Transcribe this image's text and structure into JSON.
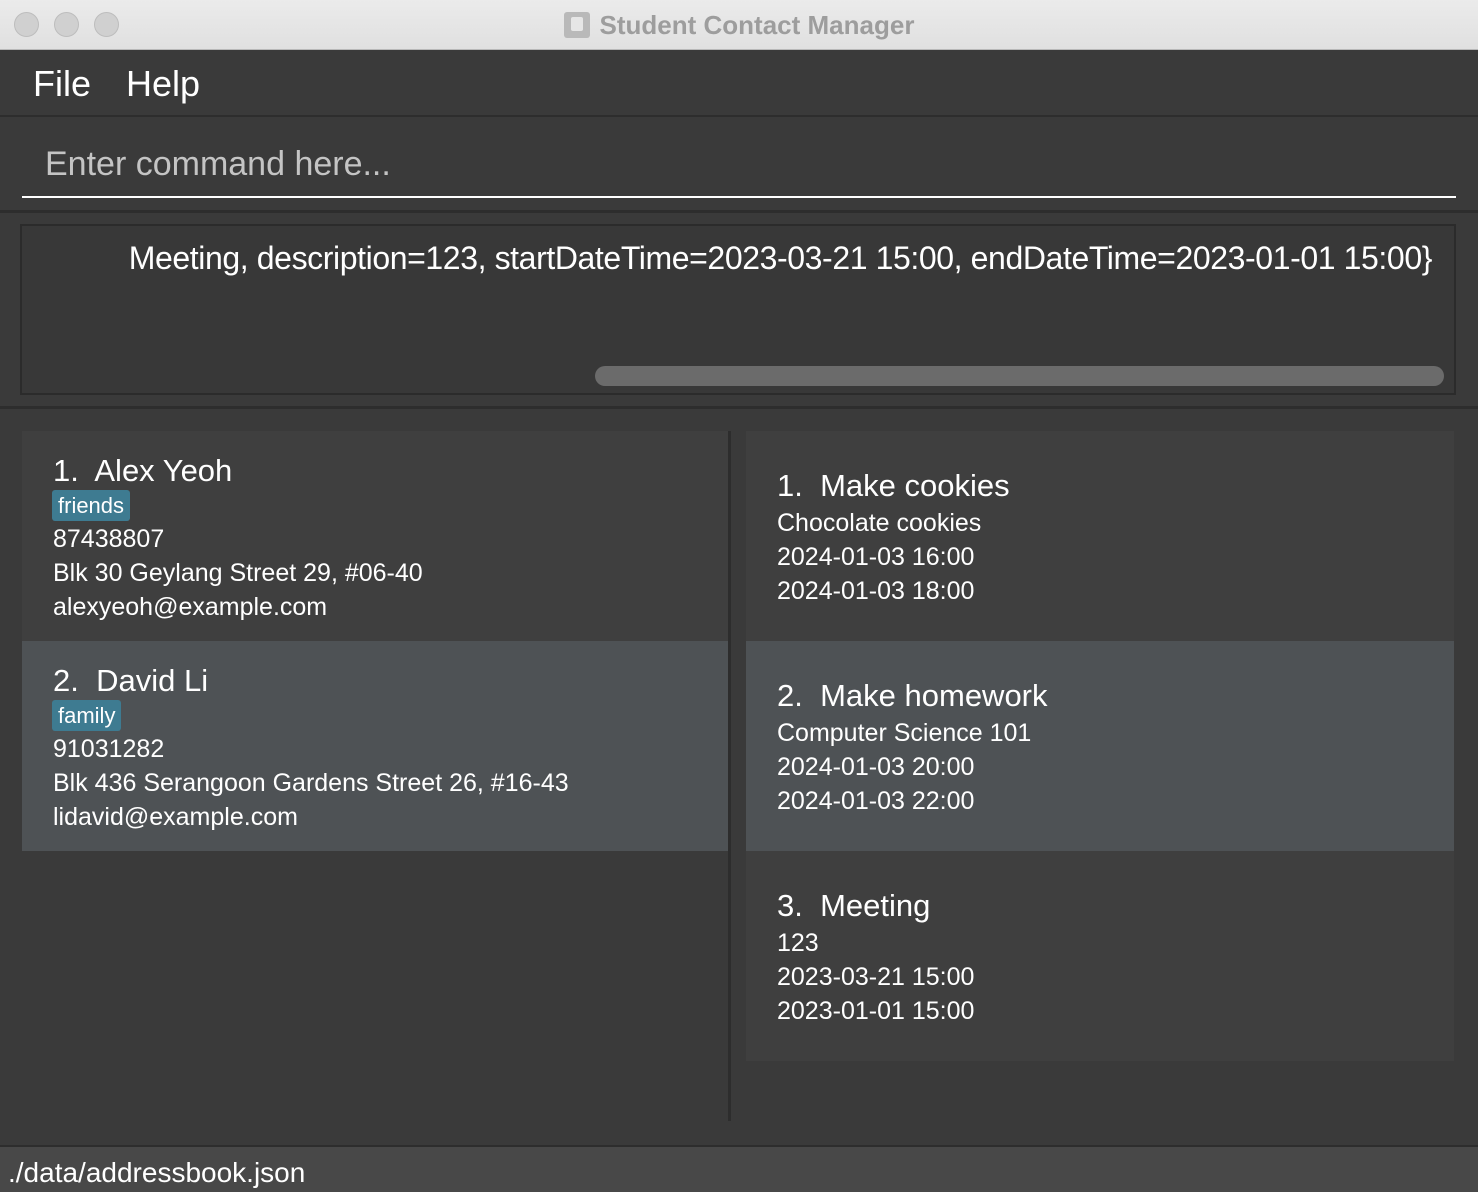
{
  "window": {
    "title": "Student Contact Manager"
  },
  "menu": {
    "file": "File",
    "help": "Help"
  },
  "command": {
    "placeholder": "Enter command here...",
    "value": ""
  },
  "result": {
    "text": "Meeting, description=123, startDateTime=2023-03-21 15:00, endDateTime=2023-01-01 15:00}"
  },
  "persons": [
    {
      "index": "1.",
      "name": "Alex Yeoh",
      "tag": "friends",
      "phone": "87438807",
      "address": "Blk 30 Geylang Street 29, #06-40",
      "email": "alexyeoh@example.com"
    },
    {
      "index": "2.",
      "name": "David Li",
      "tag": "family",
      "phone": "91031282",
      "address": "Blk 436 Serangoon Gardens Street 26, #16-43",
      "email": "lidavid@example.com"
    }
  ],
  "events": [
    {
      "index": "1.",
      "name": "Make cookies",
      "description": "Chocolate cookies",
      "start": "2024-01-03 16:00",
      "end": "2024-01-03 18:00"
    },
    {
      "index": "2.",
      "name": "Make homework",
      "description": "Computer Science 101",
      "start": "2024-01-03 20:00",
      "end": "2024-01-03 22:00"
    },
    {
      "index": "3.",
      "name": "Meeting",
      "description": "123",
      "start": "2023-03-21 15:00",
      "end": "2023-01-01 15:00"
    }
  ],
  "status": {
    "path": "./data/addressbook.json"
  }
}
